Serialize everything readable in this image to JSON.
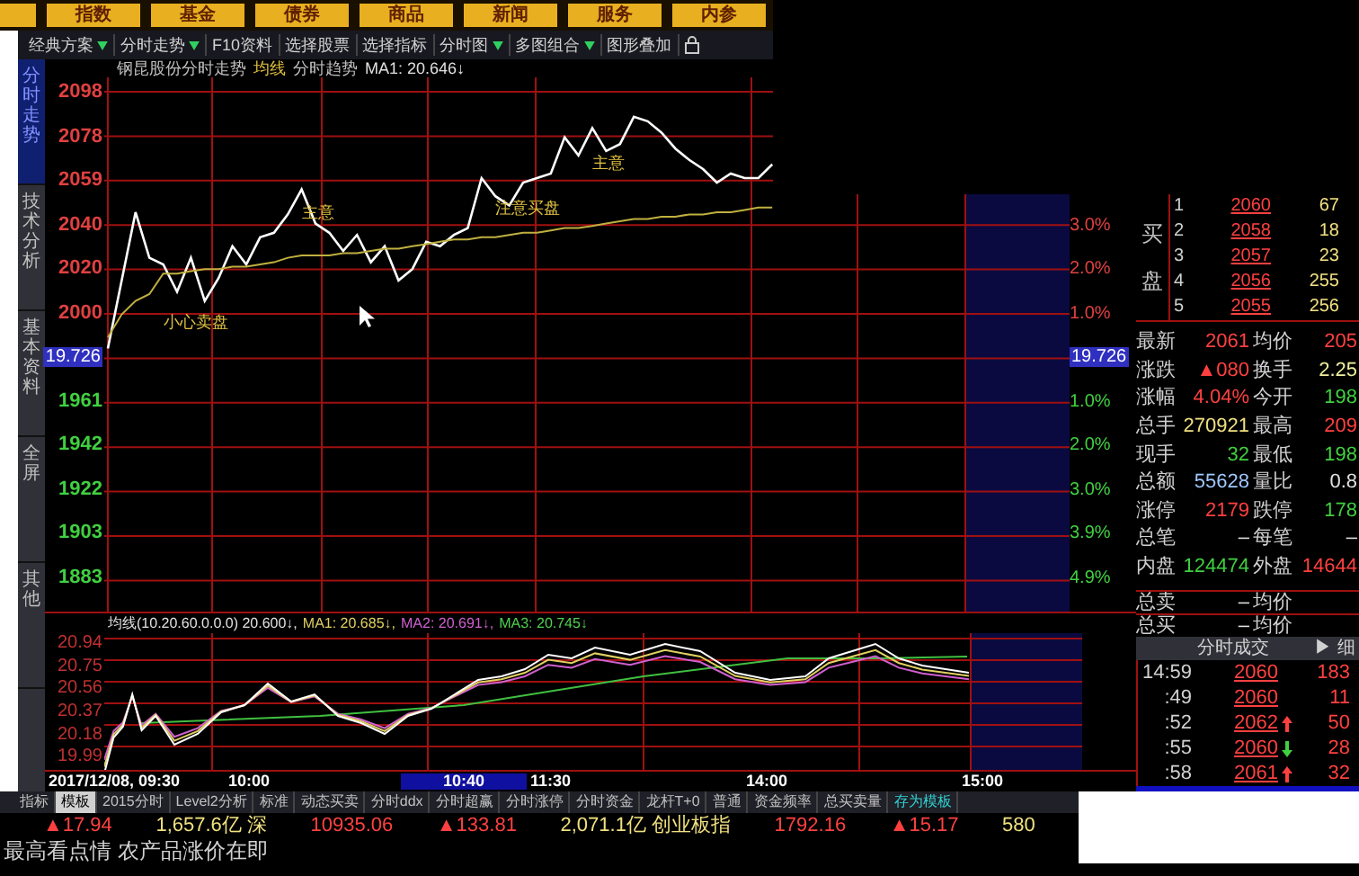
{
  "nav_tabs": [
    {
      "label": "指数"
    },
    {
      "label": "基金"
    },
    {
      "label": "债券"
    },
    {
      "label": "商品"
    },
    {
      "label": "新闻"
    },
    {
      "label": "服务"
    },
    {
      "label": "内参"
    }
  ],
  "toolbar": [
    {
      "label": "经典方案",
      "dropdown": true
    },
    {
      "label": "分时走势",
      "dropdown": true
    },
    {
      "label": "F10资料",
      "dropdown": false
    },
    {
      "label": "选择股票",
      "dropdown": false
    },
    {
      "label": "选择指标",
      "dropdown": false
    },
    {
      "label": "分时图",
      "dropdown": true
    },
    {
      "label": "多图组合",
      "dropdown": true
    },
    {
      "label": "图形叠加",
      "dropdown": false
    }
  ],
  "side_tabs": [
    {
      "label": "分时走势",
      "selected": true
    },
    {
      "label": "技术分析",
      "selected": false
    },
    {
      "label": "基本资料",
      "selected": false
    },
    {
      "label": "全屏",
      "selected": false
    },
    {
      "label": "其他",
      "selected": false
    }
  ],
  "chart": {
    "title": "钢昆股份分时走势",
    "legend": [
      {
        "text": "均线",
        "color": "#e0c040"
      },
      {
        "text": "分时趋势",
        "color": "#c0c0c0"
      },
      {
        "text": "MA1: 20.646↓",
        "color": "#e0e0e0"
      }
    ],
    "current_values": [
      "19.726",
      "19.726"
    ],
    "chart_data": {
      "type": "line",
      "categories": [
        null,
        null,
        null,
        null,
        null,
        null,
        null,
        null,
        null,
        null,
        null,
        null,
        null,
        null,
        null,
        null,
        null,
        null,
        null,
        null,
        null,
        null,
        null,
        null,
        null,
        null,
        null,
        null,
        null,
        null,
        null,
        null,
        null,
        null,
        null,
        null,
        null,
        null,
        null,
        null,
        null,
        null,
        null,
        null,
        null,
        null,
        null,
        null,
        null
      ],
      "series": [
        {
          "color": "#ffffff",
          "values": [
            1985,
            2015,
            2045,
            2025,
            2022,
            2010,
            2025,
            2006,
            2016,
            2030,
            2022,
            2034,
            2036,
            2044,
            2055,
            2040,
            2036,
            2028,
            2035,
            2023,
            2030,
            2015,
            2020,
            2032,
            2030,
            2035,
            2038,
            2060,
            2052,
            2048,
            2058,
            2060,
            2062,
            2078,
            2070,
            2082,
            2072,
            2075,
            2087,
            2085,
            2080,
            2073,
            2068,
            2064,
            2058,
            2062,
            2060,
            2060,
            2066
          ]
        },
        {
          "color": "#c0b040",
          "values": [
            1990,
            2000,
            2006,
            2009,
            2018,
            2018,
            2019,
            2020,
            2020,
            2021,
            2021,
            2022,
            2023,
            2025,
            2026,
            2026,
            2026,
            2027,
            2027,
            2028,
            2029,
            2029,
            2030,
            2031,
            2032,
            2033,
            2033,
            2034,
            2034,
            2035,
            2036,
            2036,
            2037,
            2038,
            2038,
            2039,
            2040,
            2041,
            2042,
            2042,
            2043,
            2043,
            2044,
            2044,
            2045,
            2045,
            2046,
            2047,
            2047
          ]
        }
      ],
      "ylim": [
        1883,
        2098
      ],
      "grid": true,
      "yticks": [
        2098,
        2078,
        2059,
        2040,
        2020,
        2000,
        1961,
        1942,
        1922,
        1903,
        1883
      ]
    },
    "pct_labels": [
      {
        "text": "3.0%",
        "color": "#e04040"
      },
      {
        "text": "2.0%",
        "color": "#e04040"
      },
      {
        "text": "1.0%",
        "color": "#e04040"
      },
      {
        "text": "1.0%",
        "color": "#40d040"
      },
      {
        "text": "2.0%",
        "color": "#40d040"
      },
      {
        "text": "3.0%",
        "color": "#40d040"
      },
      {
        "text": "3.9%",
        "color": "#40d040"
      },
      {
        "text": "4.9%",
        "color": "#40d040"
      }
    ],
    "annotations": [
      {
        "text": "小心卖盘"
      },
      {
        "text": "主意"
      },
      {
        "text": "注意买盘"
      },
      {
        "text": "主意"
      }
    ]
  },
  "indicator": {
    "legend": [
      {
        "text": "均线(10.20.60.0.0.0) 20.600↓,",
        "color": "#e0e0e0"
      },
      {
        "text": "MA1: 20.685↓,",
        "color": "#e0d060"
      },
      {
        "text": "MA2: 20.691↓,",
        "color": "#d060d0"
      },
      {
        "text": "MA3: 20.745↓",
        "color": "#50d050"
      }
    ],
    "y_labels": [
      "20.94",
      "20.75",
      "20.56",
      "20.37",
      "20.18",
      "19.99"
    ]
  },
  "time_axis": [
    {
      "label": "2017/12/08, 09:30",
      "selected": false
    },
    {
      "label": "10:00",
      "selected": false
    },
    {
      "label": "10:40",
      "selected": true
    },
    {
      "label": "11:30",
      "selected": false
    },
    {
      "label": "14:00",
      "selected": false
    },
    {
      "label": "15:00",
      "selected": false
    }
  ],
  "order_book": {
    "side_label": "买盘",
    "levels": [
      {
        "index": "1",
        "price": "2060",
        "volume": "67"
      },
      {
        "index": "2",
        "price": "2058",
        "volume": "18"
      },
      {
        "index": "3",
        "price": "2057",
        "volume": "23"
      },
      {
        "index": "4",
        "price": "2056",
        "volume": "255"
      },
      {
        "index": "5",
        "price": "2055",
        "volume": "256"
      }
    ]
  },
  "stats": [
    {
      "cells": [
        {
          "label": "最新",
          "value": "2061",
          "color": "#ff4040"
        },
        {
          "label": "均价",
          "value": "205",
          "color": "#ff4040"
        }
      ]
    },
    {
      "cells": [
        {
          "label": "涨跌",
          "value": "▲080",
          "color": "#ff4040"
        },
        {
          "label": "换手",
          "value": "2.25",
          "color": "#f0f0a0"
        }
      ]
    },
    {
      "cells": [
        {
          "label": "涨幅",
          "value": "4.04%",
          "color": "#ff4040"
        },
        {
          "label": "今开",
          "value": "198",
          "color": "#40d040"
        }
      ]
    },
    {
      "cells": [
        {
          "label": "总手",
          "value": "270921",
          "color": "#f0e080"
        },
        {
          "label": "最高",
          "value": "209",
          "color": "#ff4040"
        }
      ]
    },
    {
      "cells": [
        {
          "label": "现手",
          "value": "32",
          "color": "#40d040"
        },
        {
          "label": "最低",
          "value": "198",
          "color": "#40d040"
        }
      ]
    },
    {
      "cells": [
        {
          "label": "总额",
          "value": "55628",
          "color": "#a0c8ff"
        },
        {
          "label": "量比",
          "value": "0.8",
          "color": "#e0e0e0"
        }
      ]
    },
    {
      "cells": [
        {
          "label": "涨停",
          "value": "2179",
          "color": "#ff4040"
        },
        {
          "label": "跌停",
          "value": "178",
          "color": "#40d040"
        }
      ]
    },
    {
      "cells": [
        {
          "label": "总笔",
          "value": "–",
          "color": "#e0e0e0"
        },
        {
          "label": "每笔",
          "value": "–",
          "color": "#e0e0e0"
        }
      ]
    },
    {
      "cells": [
        {
          "label": "内盘",
          "value": "124474",
          "color": "#40d040"
        },
        {
          "label": "外盘",
          "value": "14644",
          "color": "#ff4040"
        }
      ]
    }
  ],
  "totals": [
    {
      "label": "总卖",
      "value": "–",
      "label2": "均价"
    },
    {
      "label": "总买",
      "value": "–",
      "label2": "均价"
    }
  ],
  "trades": {
    "title": "分时成交",
    "detail": "▶ 细",
    "rows": [
      {
        "time": "14:59",
        "price": "2060",
        "kind": "plain",
        "volume": "183"
      },
      {
        "time": ":49",
        "price": "2060",
        "kind": "plain",
        "volume": "11"
      },
      {
        "time": ":52",
        "price": "2062",
        "kind": "up",
        "volume": "50"
      },
      {
        "time": ":55",
        "price": "2060",
        "kind": "down",
        "volume": "28"
      },
      {
        "time": ":58",
        "price": "2061",
        "kind": "up",
        "volume": "32"
      }
    ]
  },
  "bottom_tabs": [
    {
      "label": "指标",
      "kind": "tab",
      "selected": false
    },
    {
      "label": "模板",
      "kind": "tab",
      "selected": true
    },
    {
      "label": "2015分时",
      "kind": "tab",
      "selected": false
    },
    {
      "label": "Level2分析",
      "kind": "tab",
      "selected": false
    },
    {
      "label": "标准",
      "kind": "tab",
      "selected": false
    },
    {
      "label": "动态买卖",
      "kind": "tab",
      "selected": false
    },
    {
      "label": "分时ddx",
      "kind": "tab",
      "selected": false
    },
    {
      "label": "分时超赢",
      "kind": "tab",
      "selected": false
    },
    {
      "label": "分时涨停",
      "kind": "tab",
      "selected": false
    },
    {
      "label": "分时资金",
      "kind": "tab",
      "selected": false
    },
    {
      "label": "龙杆T+0",
      "kind": "tab",
      "selected": false
    },
    {
      "label": "普通",
      "kind": "tab",
      "selected": false
    },
    {
      "label": "资金频率",
      "kind": "tab",
      "selected": false
    },
    {
      "label": "总买卖量",
      "kind": "tab",
      "selected": false
    },
    {
      "label": "存为模板",
      "kind": "action",
      "selected": false
    }
  ],
  "ticker": [
    {
      "text": "▲17.94",
      "color": "#ff4040"
    },
    {
      "text": "1,657.6亿 深",
      "color": "#f0e080"
    },
    {
      "text": "10935.06",
      "color": "#ff4040"
    },
    {
      "text": "▲133.81",
      "color": "#ff4040"
    },
    {
      "text": "2,071.1亿 创业板指",
      "color": "#f0e080"
    },
    {
      "text": "1792.16",
      "color": "#ff4040"
    },
    {
      "text": "▲15.17",
      "color": "#ff4040"
    },
    {
      "text": "580",
      "color": "#f0e080"
    }
  ],
  "news": "最高看点情 农产品涨价在即"
}
